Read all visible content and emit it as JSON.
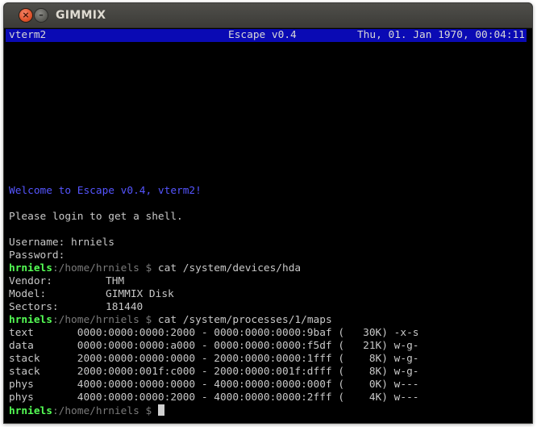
{
  "window": {
    "title": "GIMMIX",
    "close_glyph": "×",
    "minimize_glyph": "–"
  },
  "statusbar": {
    "left": "vterm2",
    "center": "Escape v0.4",
    "right": "Thu, 01. Jan 1970, 00:04:11"
  },
  "terminal": {
    "welcome": "Welcome to Escape v0.4, vterm2!",
    "login_prompt": "Please login to get a shell.",
    "username_label": "Username: hrniels",
    "password_label": "Password:",
    "prompt_user": "hrniels",
    "prompt_path": ":/home/hrniels $",
    "command1": " cat /system/devices/hda",
    "device_info": [
      {
        "key": "Vendor:",
        "value": "THM"
      },
      {
        "key": "Model:",
        "value": "GIMMIX Disk"
      },
      {
        "key": "Sectors:",
        "value": "181440"
      }
    ],
    "command2": " cat /system/processes/1/maps",
    "maps": [
      "text       0000:0000:0000:2000 - 0000:0000:0000:9baf (   30K) -x-s",
      "data       0000:0000:0000:a000 - 0000:0000:0000:f5df (   21K) w-g-",
      "stack      2000:0000:0000:0000 - 2000:0000:0000:1fff (    8K) w-g-",
      "stack      2000:0000:001f:c000 - 2000:0000:001f:dfff (    8K) w-g-",
      "phys       4000:0000:0000:0000 - 4000:0000:0000:000f (    0K) w---",
      "phys       4000:0000:0000:2000 - 4000:0000:0000:2fff (    4K) w---"
    ]
  }
}
